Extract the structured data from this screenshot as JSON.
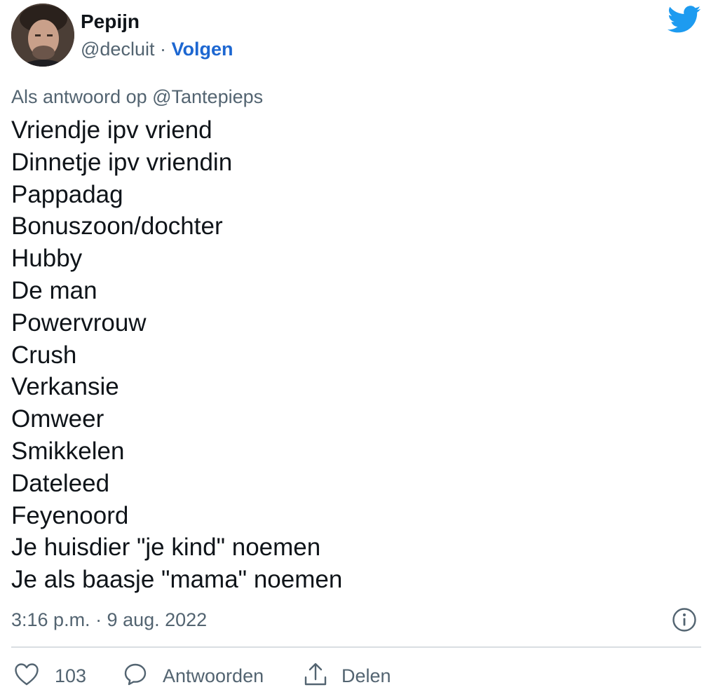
{
  "author": {
    "name": "Pepijn",
    "handle": "@decluit",
    "separator": " · ",
    "follow_label": "Volgen"
  },
  "tweet": {
    "reply_context": "Als antwoord op @Tantepieps",
    "lines": [
      "Vriendje ipv vriend",
      "Dinnetje ipv vriendin",
      "Pappadag",
      "Bonuszoon/dochter",
      "Hubby",
      "De man",
      "Powervrouw",
      "Crush",
      "Verkansie",
      "Omweer",
      "Smikkelen",
      "Dateleed",
      "Feyenoord",
      "Je huisdier \"je kind\" noemen",
      "Je als baasje \"mama\" noemen"
    ],
    "timestamp": "3:16 p.m. · 9 aug. 2022"
  },
  "actions": {
    "like_count": "103",
    "reply_label": "Antwoorden",
    "share_label": "Delen"
  },
  "icons": {
    "logo": "twitter-bird-icon",
    "info": "info-icon",
    "like": "heart-icon",
    "reply": "speech-bubble-icon",
    "share": "share-upload-icon"
  },
  "colors": {
    "brand_blue": "#1d9bf0",
    "link_blue": "#1d67d1",
    "secondary_text": "#536471",
    "primary_text": "#0f1419"
  }
}
